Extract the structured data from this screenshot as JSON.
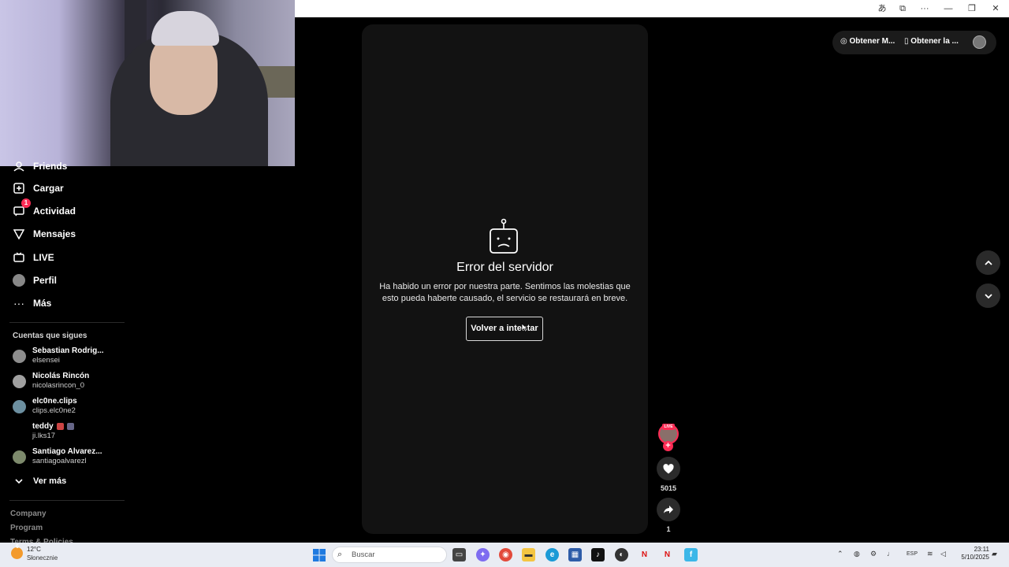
{
  "sidebar": {
    "items": [
      {
        "label": "Friends",
        "icon": "friends-icon"
      },
      {
        "label": "Cargar",
        "icon": "upload-icon"
      },
      {
        "label": "Actividad",
        "icon": "activity-icon",
        "badge": "1"
      },
      {
        "label": "Mensajes",
        "icon": "messages-icon"
      },
      {
        "label": "LIVE",
        "icon": "live-icon"
      },
      {
        "label": "Perfil",
        "icon": "profile-icon"
      },
      {
        "label": "Más",
        "icon": "more-icon"
      }
    ],
    "following_title": "Cuentas que sigues",
    "accounts": [
      {
        "name": "Sebastian Rodrig...",
        "handle": "elsensei"
      },
      {
        "name": "Nicolás Rincón",
        "handle": "nicolasrincon_0"
      },
      {
        "name": "elc0ne.clips",
        "handle": "clips.elc0ne2"
      },
      {
        "name": "teddy",
        "handle": "ji.lks17"
      },
      {
        "name": "Santiago Alvarez...",
        "handle": "santiagoalvarezl"
      }
    ],
    "see_more": "Ver más",
    "footer": [
      "Company",
      "Program",
      "Terms & Policies"
    ]
  },
  "top_bar": {
    "get_app_pc": "Obtener M...",
    "get_app_mobile": "Obtener la ..."
  },
  "error": {
    "title": "Error del servidor",
    "message_line1": "Ha habido un error por nuestra parte. Sentimos las molestias que",
    "message_line2": "esto pueda haberte causado, el servicio se restaurará en breve.",
    "retry": "Volver a intentar"
  },
  "actions": {
    "live_tag": "LIVE",
    "likes": "5015",
    "shares": "1"
  },
  "taskbar": {
    "weather_badge": "6",
    "weather_temp": "12°C",
    "weather_desc": "Słonecznie",
    "search_placeholder": "Buscar",
    "lang": "ESP",
    "time": "23:11",
    "date": "5/10/2025"
  },
  "colors": {
    "accent": "#fe2c55",
    "panel": "#121212"
  }
}
